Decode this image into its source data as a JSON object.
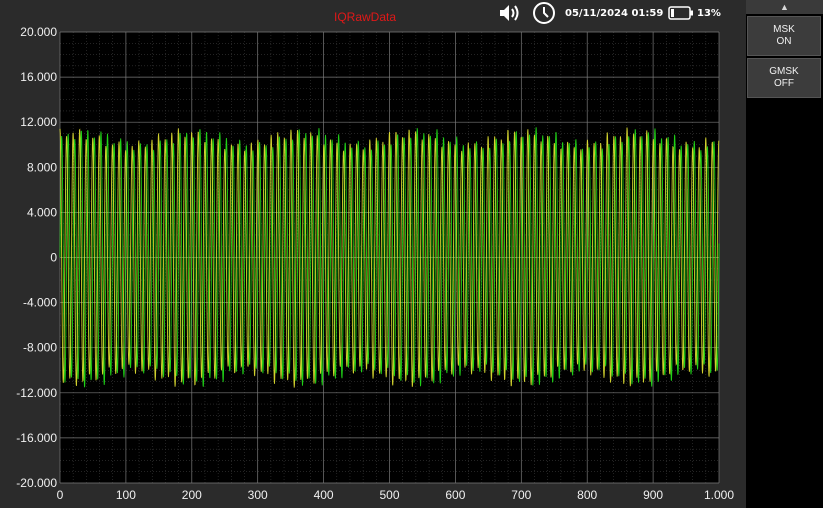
{
  "status_bar": {
    "date_time": "05/11/2024  01:59",
    "battery": "13%",
    "icons": [
      "speaker-icon",
      "clock-icon",
      "battery-icon"
    ]
  },
  "side_panel": {
    "scroll_up_glyph": "▲",
    "buttons": [
      {
        "name": "MSK",
        "state": "ON"
      },
      {
        "name": "GMSK",
        "state": "OFF"
      }
    ]
  },
  "chart_data": {
    "type": "line",
    "title": "IQRawData",
    "xlim": [
      0,
      1000
    ],
    "ylim": [
      -20000,
      20000
    ],
    "x_ticks": [
      0,
      100,
      200,
      300,
      400,
      500,
      600,
      700,
      800,
      900,
      1000
    ],
    "x_tick_labels": [
      "0",
      "100",
      "200",
      "300",
      "400",
      "500",
      "600",
      "700",
      "800",
      "900",
      "1.000"
    ],
    "y_ticks": [
      20000,
      16000,
      12000,
      8000,
      4000,
      0,
      -4000,
      -8000,
      -12000,
      -16000,
      -20000
    ],
    "y_tick_labels": [
      "20.000",
      "16.000",
      "12.000",
      "8.000",
      "4.000",
      "0",
      "-4.000",
      "-8.000",
      "-12.000",
      "-16.000",
      "-20.000"
    ],
    "grid": true,
    "series": [
      {
        "color": "#22e81a",
        "amplitude": 10500,
        "cycles": 100,
        "phase": 0
      },
      {
        "color": "#e8e832",
        "amplitude": 10500,
        "cycles": 100,
        "phase": 1.5708
      }
    ]
  }
}
